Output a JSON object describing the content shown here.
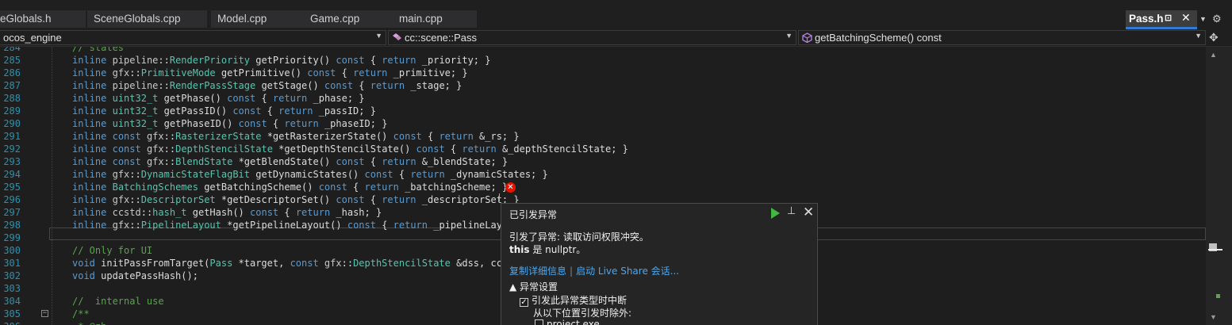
{
  "tabs": [
    {
      "label": "eGlobals.h"
    },
    {
      "label": "SceneGlobals.cpp"
    },
    {
      "label": "Model.cpp"
    },
    {
      "label": "Game.cpp"
    },
    {
      "label": "main.cpp"
    },
    {
      "label": "Pass.h"
    }
  ],
  "navbar": {
    "project": "ocos_engine",
    "scope": "cc::scene::Pass",
    "member": "getBatchingScheme() const"
  },
  "lines": [
    {
      "n": "284",
      "code": "// states"
    },
    {
      "n": "285",
      "code": "inline pipeline::RenderPriority getPriority() const { return _priority; }"
    },
    {
      "n": "286",
      "code": "inline gfx::PrimitiveMode getPrimitive() const { return _primitive; }"
    },
    {
      "n": "287",
      "code": "inline pipeline::RenderPassStage getStage() const { return _stage; }"
    },
    {
      "n": "288",
      "code": "inline uint32_t getPhase() const { return _phase; }"
    },
    {
      "n": "289",
      "code": "inline uint32_t getPassID() const { return _passID; }"
    },
    {
      "n": "290",
      "code": "inline uint32_t getPhaseID() const { return _phaseID; }"
    },
    {
      "n": "291",
      "code": "inline const gfx::RasterizerState *getRasterizerState() const { return &_rs; }"
    },
    {
      "n": "292",
      "code": "inline const gfx::DepthStencilState *getDepthStencilState() const { return &_depthStencilState; }"
    },
    {
      "n": "293",
      "code": "inline const gfx::BlendState *getBlendState() const { return &_blendState; }"
    },
    {
      "n": "294",
      "code": "inline gfx::DynamicStateFlagBit getDynamicStates() const { return _dynamicStates; }"
    },
    {
      "n": "295",
      "code": "inline BatchingSchemes getBatchingScheme() const { return _batchingScheme; }"
    },
    {
      "n": "296",
      "code": "inline gfx::DescriptorSet *getDescriptorSet() const { return _descriptorSet; }"
    },
    {
      "n": "297",
      "code": "inline ccstd::hash_t getHash() const { return _hash; }"
    },
    {
      "n": "298",
      "code": "inline gfx::PipelineLayout *getPipelineLayout() const { return _pipelineLayou"
    },
    {
      "n": "299",
      "code": ""
    },
    {
      "n": "300",
      "code": "// Only for UI"
    },
    {
      "n": "301",
      "code": "void initPassFromTarget(Pass *target, const gfx::DepthStencilState &dss, ccst"
    },
    {
      "n": "302",
      "code": "void updatePassHash();"
    },
    {
      "n": "303",
      "code": ""
    },
    {
      "n": "304",
      "code": "//  internal use"
    },
    {
      "n": "305",
      "code": "/**"
    },
    {
      "n": "306",
      "code": " * @zh"
    }
  ],
  "popup": {
    "title": "已引发异常",
    "message": "引发了异常: 读取访问权限冲突。",
    "detail_bold": "this",
    "detail_rest": " 是 nullptr。",
    "link_copy": "复制详细信息",
    "link_share": "启动 Live Share 会话...",
    "settings_header": "▲ 异常设置",
    "break_label": "引发此异常类型时中断",
    "except_label": "从以下位置引发时除外:",
    "exe_label": "project.exe"
  },
  "colors": {
    "accent": "#2f7bd6",
    "error": "#e51400",
    "link": "#4ea6ea",
    "continue": "#3fb93f"
  }
}
